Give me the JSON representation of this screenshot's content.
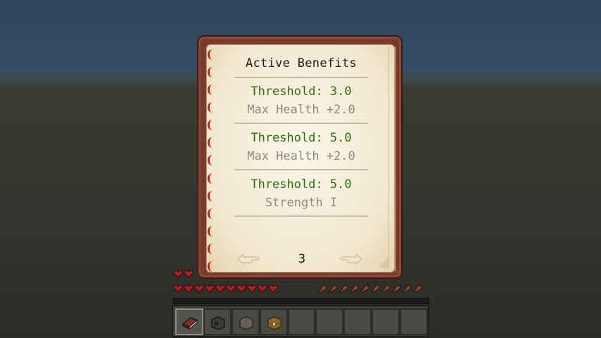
{
  "book": {
    "title": "Active Benefits",
    "entries": [
      {
        "threshold": "Threshold: 3.0",
        "benefit": "Max Health +2.0"
      },
      {
        "threshold": "Threshold: 5.0",
        "benefit": "Max Health +2.0"
      },
      {
        "threshold": "Threshold: 5.0",
        "benefit": "Strength I"
      }
    ],
    "page_number": "3",
    "prev_icon": "arrow-left-icon",
    "next_icon": "arrow-right-icon"
  },
  "hud": {
    "health_row1_hearts": 2,
    "health_row2_hearts": 10,
    "hunger_icons": 10,
    "hotbar_selected_slot": 1,
    "hotbar_slots": 9,
    "hotbar_items": [
      "book-item",
      "furnace-item",
      "leather-item",
      "chest-item",
      "",
      "",
      "",
      "",
      ""
    ]
  },
  "colors": {
    "threshold": "#2c6b14",
    "benefit": "#8a8a88",
    "cover": "#7a3b2c",
    "heart": "#b01e1e"
  }
}
